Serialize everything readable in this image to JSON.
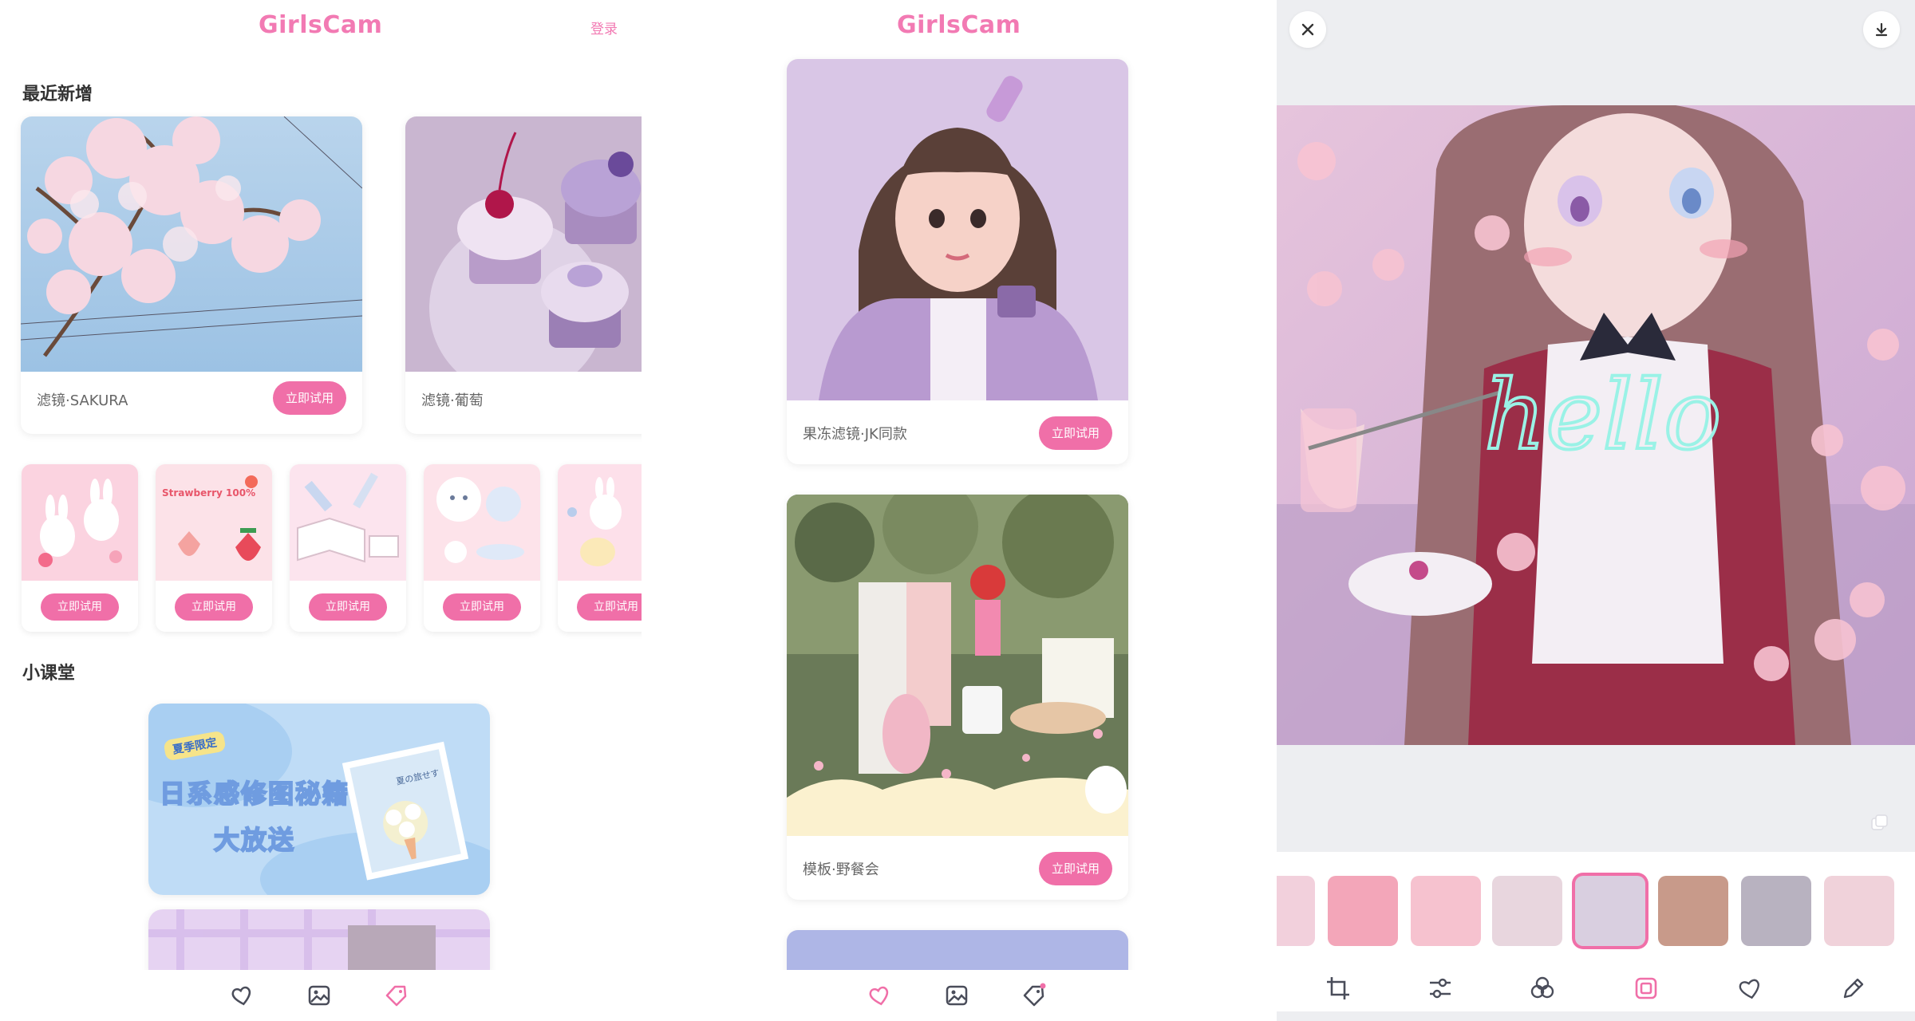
{
  "panel1": {
    "logo": "GirlsCam",
    "login": "登录",
    "recent_title": "最近新增",
    "featured": [
      {
        "caption": "滤镜·SAKURA",
        "button": "立即试用"
      },
      {
        "caption": "滤镜·葡萄",
        "button": ""
      }
    ],
    "stickers": [
      {
        "button": "立即试用"
      },
      {
        "button": "立即试用",
        "label": "Strawberry 100%"
      },
      {
        "button": "立即试用"
      },
      {
        "button": "立即试用"
      },
      {
        "button": "立即试用"
      }
    ],
    "class_title": "小课堂",
    "banner": {
      "tag": "夏季限定",
      "line1": "日系感修图秘籍",
      "line2": "大放送",
      "photo_caption": "夏の旅せす"
    }
  },
  "panel2": {
    "logo": "GirlsCam",
    "cards": [
      {
        "caption": "果冻滤镜·JK同款",
        "button": "立即试用"
      },
      {
        "caption": "模板·野餐会",
        "button": "立即试用"
      }
    ]
  },
  "panel3": {
    "overlay_text": "hello"
  },
  "colors": {
    "brand_pink": "#f27ab3",
    "button_pink": "#f06fa8"
  }
}
